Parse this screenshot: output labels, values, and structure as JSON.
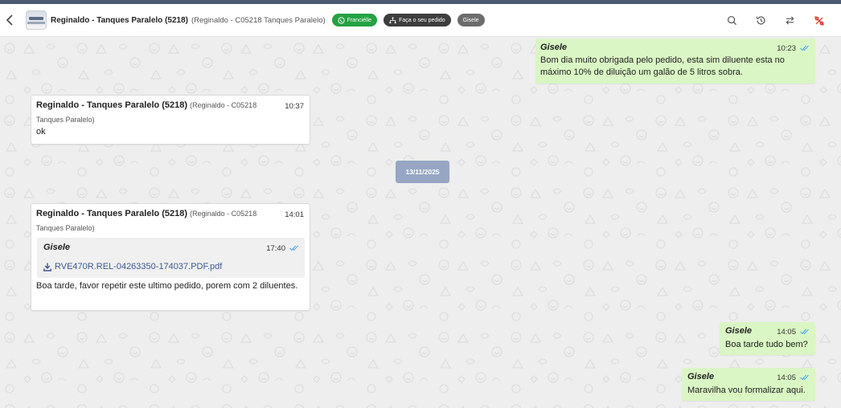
{
  "header": {
    "title": "Reginaldo - Tanques Paralelo (5218)",
    "subtitle": "(Reginaldo - C05218 Tanques Paralelo)",
    "chips": [
      {
        "label": "Franciélle",
        "icon": "whatsapp-icon",
        "color": "#25a244"
      },
      {
        "label": "Faça o seu pedido",
        "icon": "hierarchy-icon",
        "color": "#3d3d3d"
      },
      {
        "label": "Gisele",
        "icon": "",
        "color": "#6d6d6d"
      }
    ],
    "icons": [
      "search-icon",
      "history-icon",
      "transfer-icon",
      "percent-off-icon"
    ]
  },
  "colors": {
    "topbar": "#4a5a72",
    "outgoing_bubble": "#daf6c4",
    "incoming_bubble": "#ffffff",
    "date_pill": "#96a6c3",
    "read_ticks": "#4fa8e8",
    "accent_red": "#d93025"
  },
  "messages": {
    "m1": {
      "sender": "Gisele",
      "time": "10:23",
      "text": "Bom dia muito obrigada pelo pedido, esta sim diluente esta no máximo 10% de diluição um galão de 5 litros sobra."
    },
    "m2": {
      "sender": "Reginaldo - Tanques Paralelo (5218)",
      "sender_sub_a": "(Reginaldo - C05218",
      "sender_sub_b": "Tanques Paralelo)",
      "time": "10:37",
      "text": "ok"
    },
    "date_separator": "13/11/2025",
    "m3": {
      "sender": "Reginaldo - Tanques Paralelo (5218)",
      "sender_sub_a": "(Reginaldo - C05218",
      "sender_sub_b": "Tanques Paralelo)",
      "time": "14:01",
      "quote": {
        "sender": "Gisele",
        "time": "17:40",
        "file": "RVE470R.REL-04263350-174037.PDF.pdf"
      },
      "text": "Boa tarde, favor repetir este ultimo pedido, porem com 2 diluentes."
    },
    "m4": {
      "sender": "Gisele",
      "time": "14:05",
      "text": "Boa tarde tudo bem?"
    },
    "m5": {
      "sender": "Gisele",
      "time": "14:05",
      "text": "Maravilha vou formalizar aqui."
    }
  }
}
